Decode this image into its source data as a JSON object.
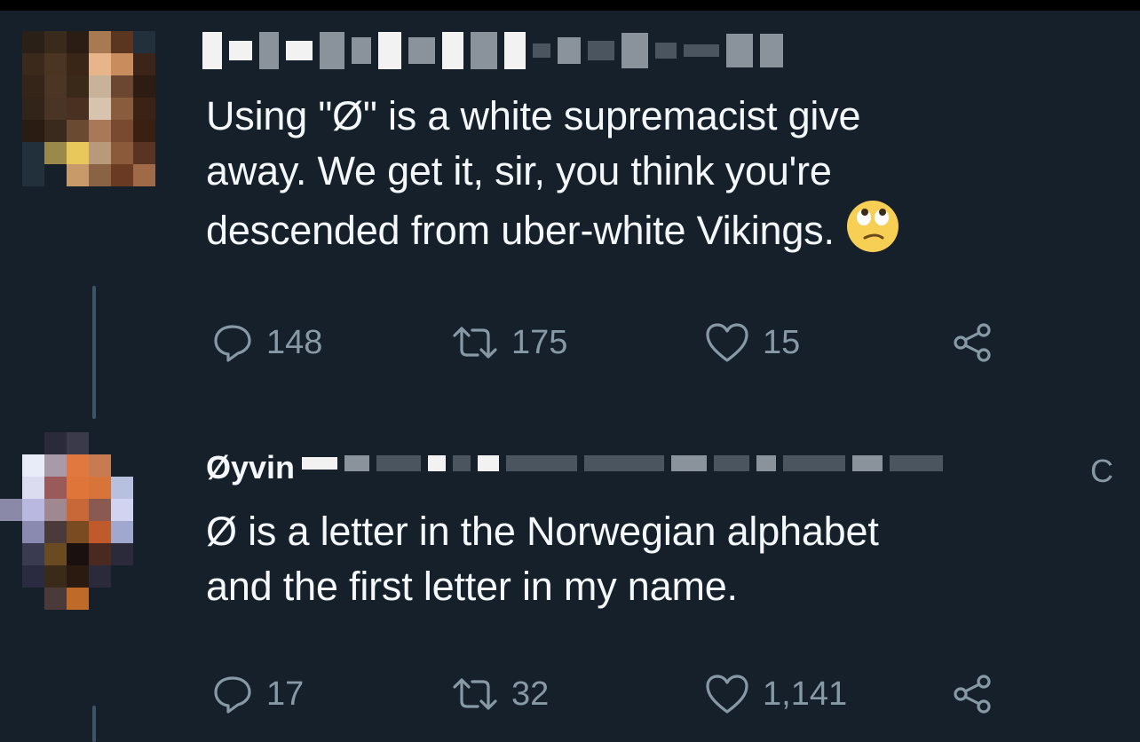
{
  "tweets": [
    {
      "author_visible": "",
      "lines": [
        "Using \"Ø\" is a white supremacist give",
        "away.  We get it, sir, you think you're",
        "descended from uber-white Vikings."
      ],
      "emoji": "face-with-rolling-eyes",
      "replies": "148",
      "retweets": "175",
      "likes": "15"
    },
    {
      "author_visible": "Øyvin",
      "author_trailing": "C",
      "lines": [
        "Ø is a letter in the Norwegian alphabet",
        "and the first letter in my name."
      ],
      "replies": "17",
      "retweets": "32",
      "likes": "1,141"
    }
  ],
  "icons": {
    "reply": "reply-icon",
    "retweet": "retweet-icon",
    "like": "heart-icon",
    "share": "share-icon"
  },
  "colors": {
    "background": "#15202b",
    "text": "#f5f8fa",
    "secondary": "#8899a6"
  }
}
